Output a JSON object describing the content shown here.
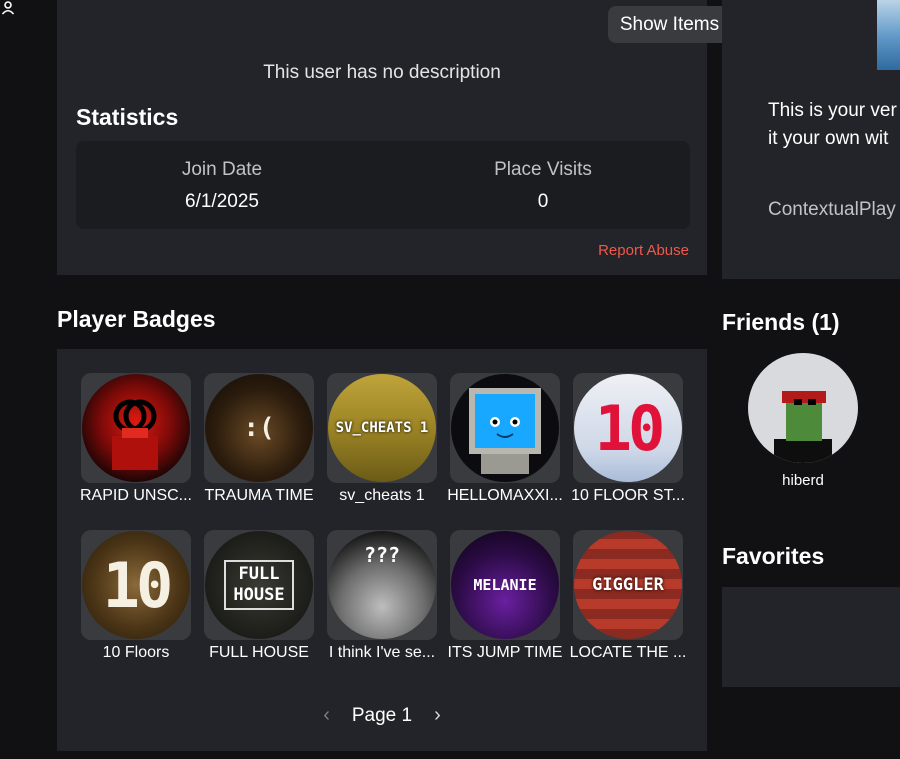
{
  "about": {
    "show_items": "Show Items",
    "description": "This user has no description",
    "statistics_title": "Statistics",
    "join_date_label": "Join Date",
    "join_date_value": "6/1/2025",
    "place_visits_label": "Place Visits",
    "place_visits_value": "0",
    "report_abuse": "Report Abuse"
  },
  "right_card": {
    "line1": "This is your ver",
    "line2": "it your own wit",
    "line3": "ContextualPlay"
  },
  "badges": {
    "title": "Player Badges",
    "items": [
      {
        "name": "RAPID UNSC...",
        "art": "",
        "icon": "red-figure-badge"
      },
      {
        "name": "TRAUMA TIME",
        "art": ":(",
        "icon": "sad-face-badge"
      },
      {
        "name": "sv_cheats 1",
        "art": "SV_CHEATS 1",
        "icon": "sv-cheats-badge"
      },
      {
        "name": "HELLOMAXXI...",
        "art": "",
        "icon": "blue-monitor-badge"
      },
      {
        "name": "10 FLOOR ST...",
        "art": "10",
        "icon": "ten-pink-badge"
      },
      {
        "name": "10 Floors",
        "art": "10",
        "icon": "ten-brown-badge"
      },
      {
        "name": "FULL HOUSE",
        "art": "FULL HOUSE",
        "icon": "full-house-badge"
      },
      {
        "name": "I think I've se...",
        "art": "???",
        "icon": "question-marks-badge"
      },
      {
        "name": "ITS JUMP TIME",
        "art": "MELANIE",
        "icon": "melanie-badge"
      },
      {
        "name": "LOCATE THE ...",
        "art": "GIGGLER",
        "icon": "giggler-badge"
      }
    ],
    "page_label": "Page 1",
    "prev_icon": "chevron-left-icon",
    "next_icon": "chevron-right-icon"
  },
  "friends": {
    "title": "Friends (1)",
    "items": [
      {
        "name": "hiberd",
        "status_icon": "online-person-icon"
      }
    ]
  },
  "favorites": {
    "title": "Favorites"
  },
  "colors": {
    "background": "#111114",
    "panel": "#232429",
    "report": "#f0584b",
    "status": "#1e90e8"
  }
}
